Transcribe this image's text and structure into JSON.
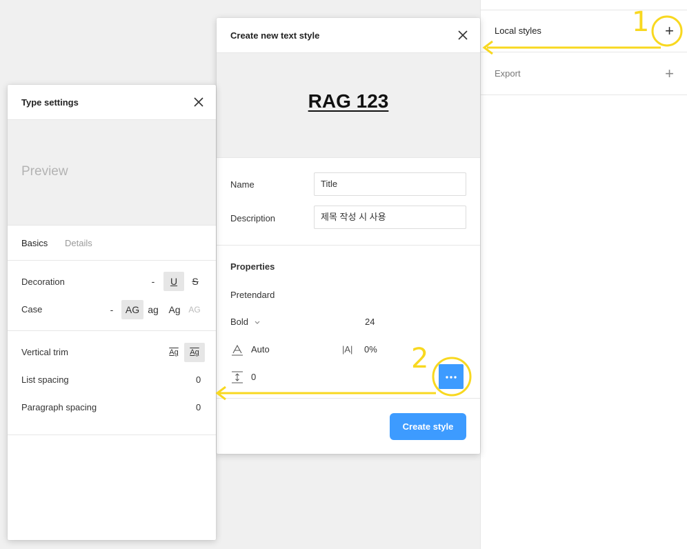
{
  "right_panel": {
    "local_styles_label": "Local styles",
    "add_local_style_icon": "+",
    "export_label": "Export",
    "add_export_icon": "+"
  },
  "create_modal": {
    "title": "Create new text style",
    "close_icon": "close-icon",
    "preview_text": "RAG 123",
    "name_label": "Name",
    "name_value": "Title",
    "description_label": "Description",
    "description_value": "제목 작성 시 사용",
    "properties_heading": "Properties",
    "font_family": "Pretendard",
    "font_weight": "Bold",
    "font_size": "24",
    "line_height": "Auto",
    "letter_spacing": "0%",
    "paragraph_spacing": "0",
    "more_button_icon": "more-icon",
    "create_button": "Create style"
  },
  "type_modal": {
    "title": "Type settings",
    "close_icon": "close-icon",
    "preview_placeholder": "Preview",
    "tabs": [
      {
        "label": "Basics",
        "active": true
      },
      {
        "label": "Details",
        "active": false
      }
    ],
    "decoration_label": "Decoration",
    "decoration_options": [
      "-",
      "U",
      "S"
    ],
    "decoration_selected": "U",
    "case_label": "Case",
    "case_options": [
      "-",
      "AG",
      "ag",
      "Ag",
      "AG"
    ],
    "case_selected": "AG",
    "vertical_trim_label": "Vertical trim",
    "vertical_trim_options": [
      "Ag",
      "Ag"
    ],
    "list_spacing_label": "List spacing",
    "list_spacing_value": "0",
    "paragraph_spacing_label": "Paragraph spacing",
    "paragraph_spacing_value": "0"
  },
  "annotations": {
    "step1": "1",
    "step2": "2",
    "color": "#f8d820"
  },
  "colors": {
    "accent_blue": "#3d9bff",
    "annotation_yellow": "#f8d820"
  }
}
